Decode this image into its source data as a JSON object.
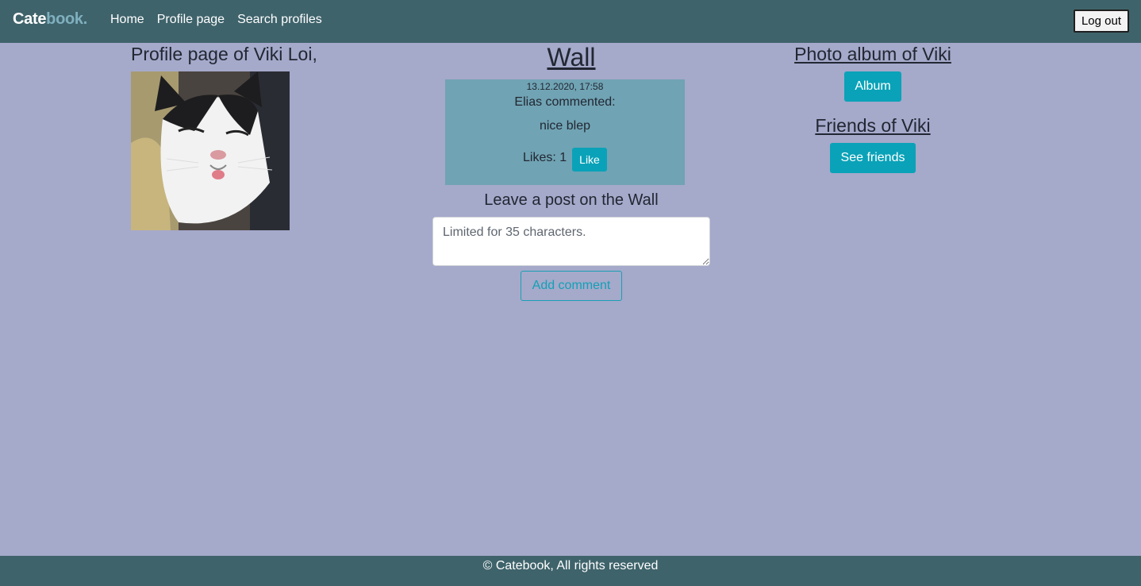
{
  "navbar": {
    "brand_part1": "Cate",
    "brand_part2": "book.",
    "links": [
      "Home",
      "Profile page",
      "Search profiles"
    ],
    "logout_label": "Log out"
  },
  "profile": {
    "title": "Profile page of Viki Loi,"
  },
  "wall": {
    "title": "Wall",
    "posts": [
      {
        "date": "13.12.2020, 17:58",
        "author_line": "Elias commented:",
        "text": "nice blep",
        "likes_text": "Likes: 1",
        "like_label": "Like"
      }
    ],
    "leave_title": "Leave a post on the Wall",
    "input_placeholder": "Limited for 35 characters.",
    "add_label": "Add comment"
  },
  "sidebar": {
    "album_title": "Photo album of Viki",
    "album_label": "Album",
    "friends_title": "Friends of Viki",
    "friends_label": "See friends"
  },
  "footer": {
    "text": "© Catebook, All rights reserved"
  },
  "colors": {
    "navbar": "#3f636b",
    "page_bg": "#a5a9ca",
    "post_card": "#70a3b3",
    "accent": "#0aa2b8"
  }
}
